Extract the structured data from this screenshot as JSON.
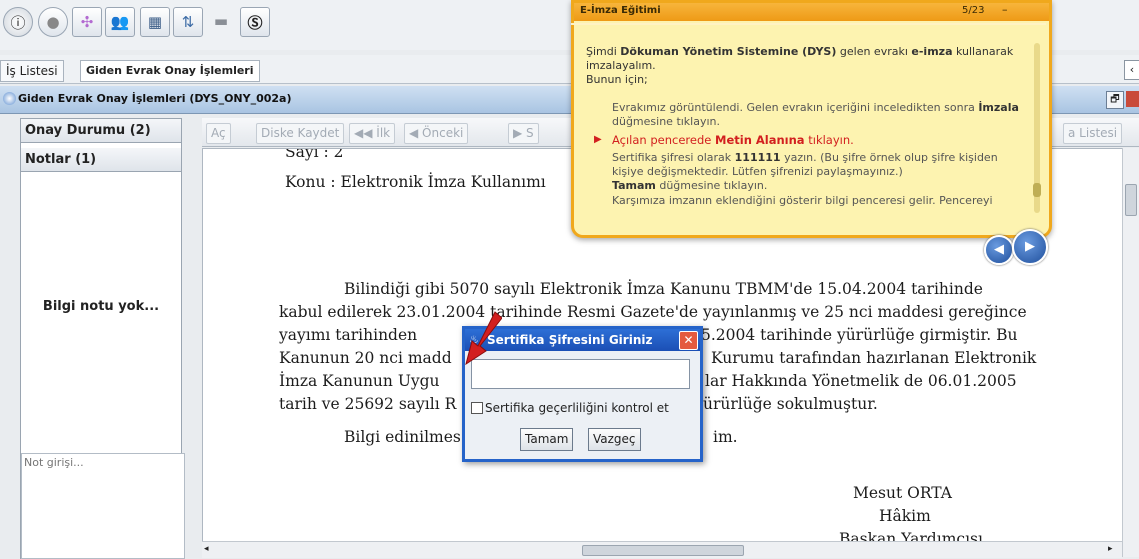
{
  "toolbar": {
    "icons": [
      "info-icon",
      "record-icon",
      "network-icon",
      "people-icon",
      "grid-icon",
      "share-icon",
      "chat-icon",
      "document-s-icon"
    ]
  },
  "tabs": {
    "is_listesi": "İş Listesi",
    "giden": "Giden Evrak Onay İşlemleri"
  },
  "window": {
    "title": "Giden Evrak Onay İşlemleri (DYS_ONY_002a)"
  },
  "left_panel": {
    "onay_durumu": "Onay Durumu (2)",
    "notlar": "Notlar (1)",
    "no_info": "Bilgi notu yok...",
    "note_placeholder": "Not girişi..."
  },
  "doc_toolbar": {
    "ac": "Aç",
    "diske_kaydet": "Diske Kaydet",
    "ilk": "İlk",
    "onceki": "Önceki",
    "s": "S",
    "liste": "a Listesi"
  },
  "document": {
    "sayi": "Sayı    :  2",
    "konu": "Konu   : Elektronik İmza Kullanımı",
    "p1": "Bilindiği  gibi 5070 sayılı Elektronik İmza Kanunu TBMM'de 15.04.2004 tarihinde",
    "p2": "kabul edilerek 23.01.2004 tarihinde Resmi Gazete'de yayınlanmış ve 25 nci maddesi gereğince",
    "p3a": "yayımı tarihinden",
    "p3b": "5.2004 tarihinde yürürlüğe girmiştir.  Bu",
    "p4a": "Kanunun 20 nci madd",
    "p4b": "Kurumu tarafından hazırlanan Elektronik",
    "p5a": "İmza Kanunun Uygu",
    "p5b": "lar Hakkında Yönetmelik de 06.01.2005",
    "p6a": "tarih ve 25692 sayılı R",
    "p6b": "ürürlüğe sokulmuştur.",
    "p7a": "Bilgi edinilmes",
    "p7b": "im.",
    "sig_name": "Mesut ORTA",
    "sig_title1": "Hâkim",
    "sig_title2": "Başkan Yardımcısı"
  },
  "dialog": {
    "title": "Sertifika Şifresini Giriniz",
    "checkbox_label": "Sertifika geçerliliğini kontrol et",
    "ok": "Tamam",
    "cancel": "Vazgeç"
  },
  "tutorial": {
    "title": "E-İmza Eğitimi",
    "counter": "5/23",
    "intro1a": "Şimdi ",
    "intro1b": "Dökuman Yönetim Sistemine (DYS)",
    "intro1c": " gelen evrakı ",
    "intro1d": "e-imza",
    "intro1e": " kullanarak",
    "intro2": "imzalayalım.",
    "intro3": "Bunun için;",
    "s1a": "Evrakımız görüntülendi. Gelen evrakın içeriğini inceledikten sonra ",
    "s1b": "İmzala",
    "s1c": "düğmesine tıklayın.",
    "s2a": "Açılan pencerede ",
    "s2b": "Metin Alanına",
    "s2c": " tıklayın.",
    "s3a": "Sertifika şifresi olarak ",
    "s3b": "111111",
    "s3c": " yazın. (Bu şifre örnek olup şifre kişiden",
    "s3d": "kişiye değişmektedir. Lütfen şifrenizi paylaşmayınız.)",
    "s4a": "Tamam",
    "s4b": " düğmesine tıklayın.",
    "s5": "Karşımıza imzanın eklendiğini gösterir bilgi penceresi gelir. Pencereyi"
  },
  "colors": {
    "accent_orange": "#f0a81c",
    "dialog_blue": "#2563c9",
    "highlight_red": "#d21f1f"
  }
}
